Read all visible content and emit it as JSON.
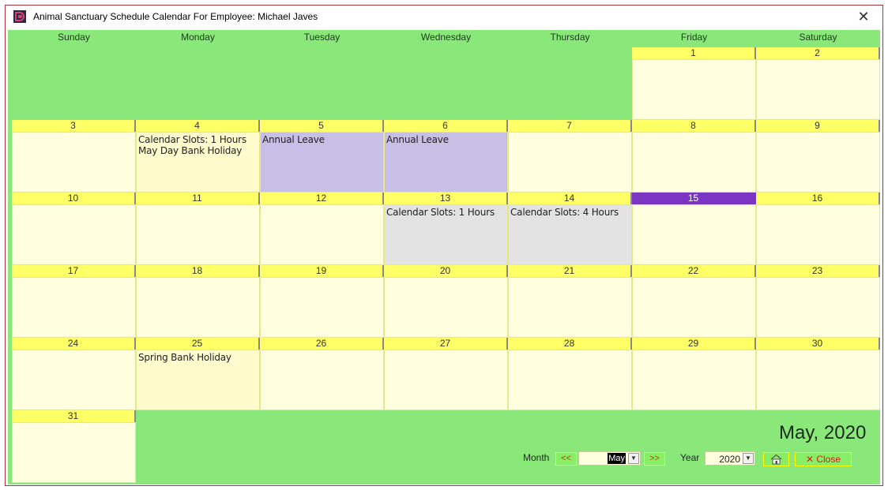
{
  "window": {
    "title": "Animal Sanctuary Schedule Calendar For Employee: Michael Javes",
    "close_glyph": "✕"
  },
  "days_of_week": [
    "Sunday",
    "Monday",
    "Tuesday",
    "Wednesday",
    "Thursday",
    "Friday",
    "Saturday"
  ],
  "calendar": {
    "month_year": "May, 2020",
    "today": "15",
    "days": [
      {
        "day": "1",
        "text": ""
      },
      {
        "day": "2",
        "text": ""
      },
      {
        "day": "3",
        "text": ""
      },
      {
        "day": "4",
        "text": "Calendar Slots: 1 Hours\nMay Day Bank Holiday",
        "kind": "holiday"
      },
      {
        "day": "5",
        "text": "Annual Leave",
        "kind": "leave"
      },
      {
        "day": "6",
        "text": "Annual Leave",
        "kind": "leave"
      },
      {
        "day": "7",
        "text": ""
      },
      {
        "day": "8",
        "text": ""
      },
      {
        "day": "9",
        "text": ""
      },
      {
        "day": "10",
        "text": ""
      },
      {
        "day": "11",
        "text": ""
      },
      {
        "day": "12",
        "text": ""
      },
      {
        "day": "13",
        "text": "Calendar Slots: 1 Hours",
        "kind": "slots"
      },
      {
        "day": "14",
        "text": "Calendar Slots: 4 Hours",
        "kind": "slots"
      },
      {
        "day": "15",
        "text": ""
      },
      {
        "day": "16",
        "text": ""
      },
      {
        "day": "17",
        "text": ""
      },
      {
        "day": "18",
        "text": ""
      },
      {
        "day": "19",
        "text": ""
      },
      {
        "day": "20",
        "text": ""
      },
      {
        "day": "21",
        "text": ""
      },
      {
        "day": "22",
        "text": ""
      },
      {
        "day": "23",
        "text": ""
      },
      {
        "day": "24",
        "text": ""
      },
      {
        "day": "25",
        "text": "Spring Bank Holiday",
        "kind": "holiday"
      },
      {
        "day": "26",
        "text": ""
      },
      {
        "day": "27",
        "text": ""
      },
      {
        "day": "28",
        "text": ""
      },
      {
        "day": "29",
        "text": ""
      },
      {
        "day": "30",
        "text": ""
      },
      {
        "day": "31",
        "text": ""
      }
    ]
  },
  "controls": {
    "month_label": "Month",
    "prev_label": "<<",
    "next_label": ">>",
    "month_value": "May",
    "year_label": "Year",
    "year_value": "2020",
    "close_label": "✕ Close",
    "home_icon": "home-icon"
  },
  "colors": {
    "background": "#8ae87a",
    "header": "#ffff66",
    "cell": "#ffffe0",
    "today": "#7a35c2",
    "leave": "#c7bfe6",
    "slots": "#e3e3e3"
  }
}
